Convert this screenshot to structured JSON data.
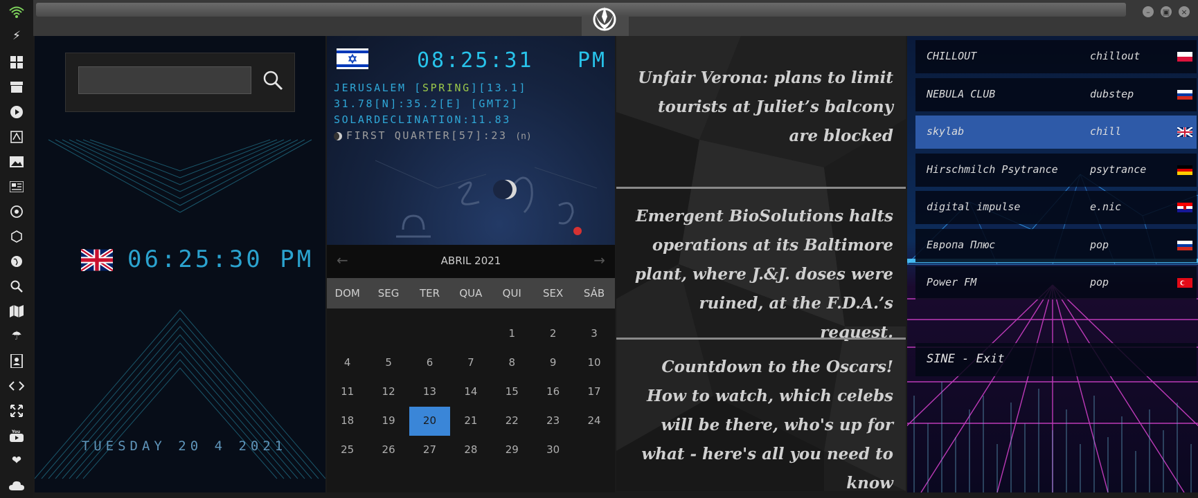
{
  "sidebar": {
    "icons": [
      "wifi-icon",
      "lightning-icon",
      "windows-icon",
      "archive-icon",
      "play-icon",
      "translate-icon",
      "image-icon",
      "news-icon",
      "aperture-icon",
      "hexagon-icon",
      "globe-icon",
      "search-icon",
      "map-icon",
      "umbrella-icon",
      "contacts-icon",
      "code-icon",
      "fullscreen-icon",
      "youtube-icon",
      "heart-icon",
      "cloud-icon"
    ]
  },
  "window": {
    "minimize_label": "–",
    "maximize_label": "▣",
    "close_label": "×"
  },
  "panel1": {
    "search": {
      "value": "",
      "placeholder": ""
    },
    "time": "06:25:30 PM",
    "date": "TUESDAY 20 4 2021"
  },
  "panel2": {
    "time": "08:25:31",
    "ampm": "PM",
    "line1_pre": "JERUSALEM [",
    "line1_season": "SPRING",
    "line1_post": "][13.1]",
    "line2": "31.78[N]:35.2[E] [GMT2]",
    "line3": "SOLARDECLINATION:11.83",
    "line4": "FIRST QUARTER[57]:23",
    "line4_hemi": "(n)",
    "calendar": {
      "month": "ABRIL 2021",
      "prev": "←",
      "next": "→",
      "weekdays": [
        "DOM",
        "SEG",
        "TER",
        "QUA",
        "QUI",
        "SEX",
        "SÁB"
      ],
      "weeks": [
        [
          "",
          "",
          "",
          "",
          "1",
          "2",
          "3"
        ],
        [
          "4",
          "5",
          "6",
          "7",
          "8",
          "9",
          "10"
        ],
        [
          "11",
          "12",
          "13",
          "14",
          "15",
          "16",
          "17"
        ],
        [
          "18",
          "19",
          "20",
          "21",
          "22",
          "23",
          "24"
        ],
        [
          "25",
          "26",
          "27",
          "28",
          "29",
          "30",
          ""
        ]
      ],
      "today": "20"
    }
  },
  "news": [
    "Unfair Verona: plans to limit tourists at Juliet’s balcony are blocked",
    "Emergent BioSolutions halts operations at its Baltimore plant, where J.&J. doses were ruined, at the F.D.A.’s request.",
    "Countdown to the Oscars! How to watch, which celebs will be there, who's up for what - here's all you need to know"
  ],
  "radio": {
    "stations": [
      {
        "name": "CHILLOUT",
        "genre": "chillout",
        "flag": "pl"
      },
      {
        "name": "NEBULA CLUB",
        "genre": "dubstep",
        "flag": "ru"
      },
      {
        "name": "skylab",
        "genre": "chill",
        "flag": "uk",
        "selected": true
      },
      {
        "name": "Hirschmilch Psytrance",
        "genre": "psytrance",
        "flag": "de"
      },
      {
        "name": "digital impulse",
        "genre": "e.nic",
        "flag": "hr"
      },
      {
        "name": "Европа Плюс",
        "genre": "pop",
        "flag": "ru"
      },
      {
        "name": "Power FM",
        "genre": "pop",
        "flag": "tr"
      }
    ],
    "exit_label": "SINE - Exit"
  },
  "colors": {
    "clock_cyan": "#28c3ea",
    "season_green": "#9bc84a",
    "today_blue": "#3a86d8",
    "selected_row": "#2e5aa8"
  }
}
